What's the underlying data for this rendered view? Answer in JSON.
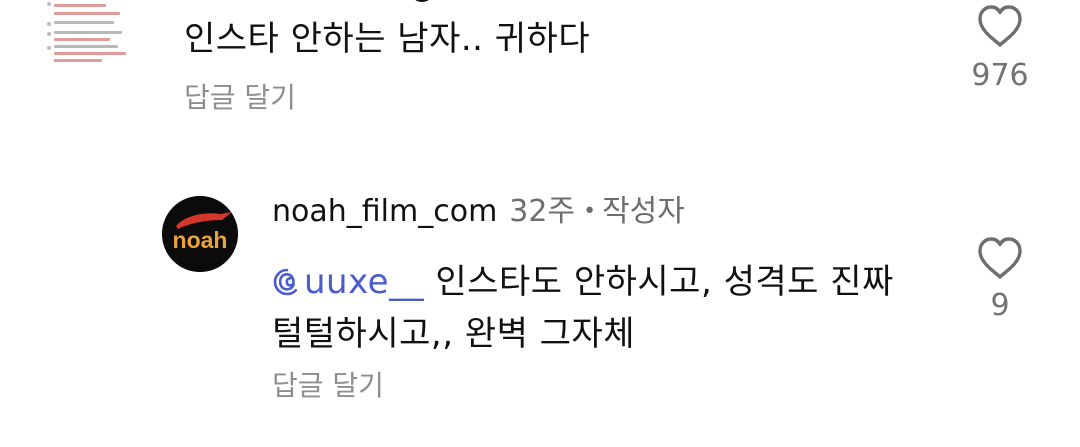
{
  "comments": [
    {
      "avatar": "screenshot-thumbnail",
      "text": "인스타 안하는 남자.. 귀하다",
      "reply_label": "답글 달기",
      "likes": "976",
      "like_icon": "heart-outline-icon"
    },
    {
      "username": "noah_film_com",
      "time": "32주",
      "separator": "•",
      "author_badge": "작성자",
      "avatar": {
        "logo_text": "noah",
        "colors": {
          "background": "#0b0b0b",
          "logo_text": "#e8a33a",
          "swoosh": "#d6372b"
        }
      },
      "mention": "uuxe__",
      "text_line1": " 인스타도 안하시고, 성격도 진짜",
      "text_line2": "털털하시고,, 완벽 그자체",
      "reply_label": "답글 달기",
      "likes": "9",
      "like_icon": "heart-outline-icon"
    }
  ],
  "colors": {
    "mention": "#4a5dcf",
    "secondary_text": "#8e8e8e",
    "primary_text": "#111111"
  }
}
